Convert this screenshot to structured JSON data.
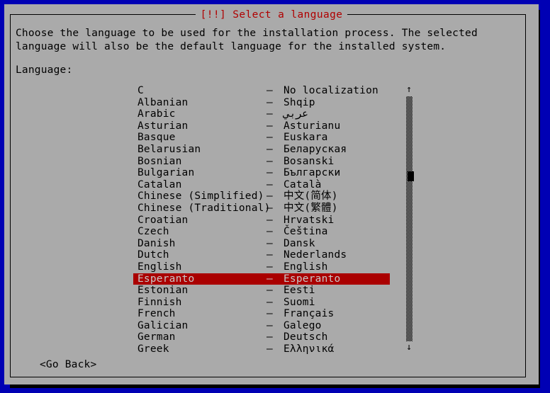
{
  "dialog": {
    "title": "[!!] Select a language",
    "title_color": "#b00000",
    "background_color": "#aaaaaa",
    "screen_color": "#0000b4",
    "prompt": "Choose the language to be used for the installation process. The selected language will also be the default language for the installed system.",
    "language_label": "Language:"
  },
  "list": {
    "separator": "–",
    "selected_index": 16,
    "items": [
      {
        "english": "C",
        "native": "No localization"
      },
      {
        "english": "Albanian",
        "native": "Shqip"
      },
      {
        "english": "Arabic",
        "native": "عربي"
      },
      {
        "english": "Asturian",
        "native": "Asturianu"
      },
      {
        "english": "Basque",
        "native": "Euskara"
      },
      {
        "english": "Belarusian",
        "native": "Беларуская"
      },
      {
        "english": "Bosnian",
        "native": "Bosanski"
      },
      {
        "english": "Bulgarian",
        "native": "Български"
      },
      {
        "english": "Catalan",
        "native": "Català"
      },
      {
        "english": "Chinese (Simplified)",
        "native": "中文(简体)"
      },
      {
        "english": "Chinese (Traditional)",
        "native": "中文(繁體)"
      },
      {
        "english": "Croatian",
        "native": "Hrvatski"
      },
      {
        "english": "Czech",
        "native": "Čeština"
      },
      {
        "english": "Danish",
        "native": "Dansk"
      },
      {
        "english": "Dutch",
        "native": "Nederlands"
      },
      {
        "english": "English",
        "native": "English"
      },
      {
        "english": "Esperanto",
        "native": "Esperanto"
      },
      {
        "english": "Estonian",
        "native": "Eesti"
      },
      {
        "english": "Finnish",
        "native": "Suomi"
      },
      {
        "english": "French",
        "native": "Français"
      },
      {
        "english": "Galician",
        "native": "Galego"
      },
      {
        "english": "German",
        "native": "Deutsch"
      },
      {
        "english": "Greek",
        "native": "Ελληνικά"
      }
    ],
    "highlight_color": "#aa0000",
    "highlight_text_color": "#c8c8c8"
  },
  "scrollbar": {
    "up_arrow": "↑",
    "down_arrow": "↓",
    "thumb_position_percent": 27
  },
  "buttons": {
    "go_back": "<Go Back>"
  }
}
